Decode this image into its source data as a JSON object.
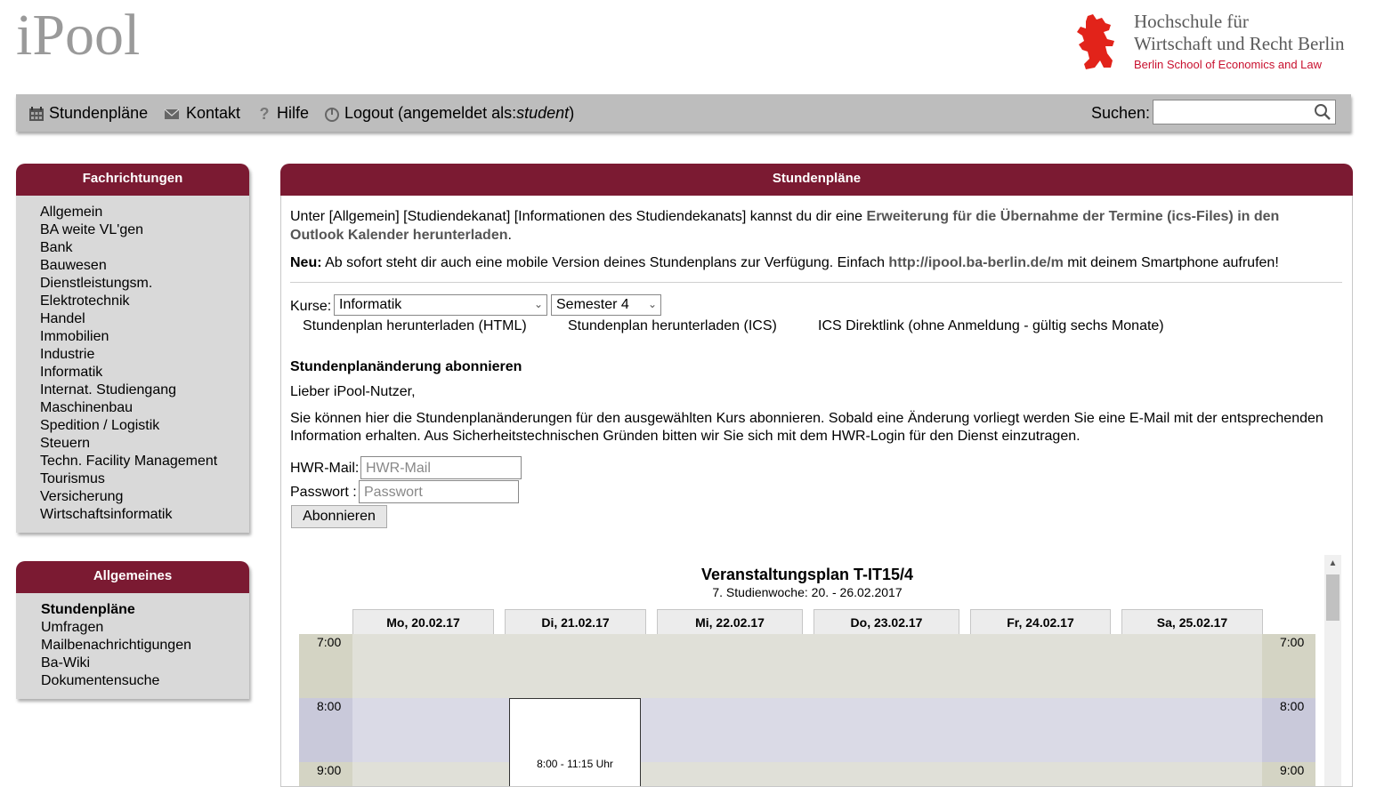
{
  "header": {
    "logo": "iPool",
    "hwr_line1": "Hochschule für",
    "hwr_line2": "Wirtschaft und Recht Berlin",
    "hwr_line3": "Berlin School of Economics and Law",
    "brand_color": "#7b1a32",
    "hwr_red": "#c8102e"
  },
  "topnav": {
    "items": [
      {
        "label": "Stundenpläne",
        "icon": "calendar-icon"
      },
      {
        "label": "Kontakt",
        "icon": "envelope-icon"
      },
      {
        "label": "Hilfe",
        "icon": "question-icon"
      },
      {
        "label": "Logout (angemeldet als: ",
        "icon": "power-icon",
        "user": "student",
        "close": ")"
      }
    ],
    "search_label": "Suchen:",
    "search_placeholder": ""
  },
  "fachrichtungen": {
    "title": "Fachrichtungen",
    "items": [
      "Allgemein",
      "BA weite VL'gen",
      "Bank",
      "Bauwesen",
      "Dienstleistungsm.",
      "Elektrotechnik",
      "Handel",
      "Immobilien",
      "Industrie",
      "Informatik",
      "Internat. Studiengang",
      "Maschinenbau",
      "Spedition / Logistik",
      "Steuern",
      "Techn. Facility Management",
      "Tourismus",
      "Versicherung",
      "Wirtschaftsinformatik"
    ]
  },
  "allgemeines": {
    "title": "Allgemeines",
    "items": [
      "Stundenpläne",
      "Umfragen",
      "Mailbenachrichtigungen",
      "Ba-Wiki",
      "Dokumentensuche"
    ],
    "active_index": 0
  },
  "main": {
    "title": "Stundenpläne",
    "info1_pre": "Unter [Allgemein] [Studiendekanat] [Informationen des Studiendekanats] kannst du dir eine ",
    "info1_link": "Erweiterung für die Übernahme der Termine (ics-Files) in den Outlook Kalender herunterladen",
    "info1_post": ".",
    "info2_bold": "Neu:",
    "info2_pre": " Ab sofort steht dir auch eine mobile Version deines Stundenplans zur Verfügung. Einfach ",
    "info2_link": "http://ipool.ba-berlin.de/m",
    "info2_post": " mit deinem Smartphone aufrufen!",
    "kurse_label": "Kurse:",
    "kurs_selected": "Informatik",
    "semester_selected": "Semester 4",
    "download_html": "Stundenplan herunterladen (HTML)",
    "download_ics": "Stundenplan herunterladen (ICS)",
    "ics_direct": "ICS Direktlink (ohne Anmeldung - gültig sechs Monate)",
    "subscribe_title": "Stundenplanänderung abonnieren",
    "greeting": "Lieber iPool-Nutzer,",
    "subscribe_text": "Sie können hier die Stundenplanänderungen für den ausgewählten Kurs abonnieren. Sobald eine Änderung vorliegt werden Sie eine E-Mail mit der entsprechenden Information erhalten. Aus Sicherheitstechnischen Gründen bitten wir Sie sich mit dem HWR-Login für den Dienst einzutragen.",
    "mail_label": "HWR-Mail:",
    "mail_placeholder": "HWR-Mail",
    "password_label": "Passwort :",
    "password_placeholder": "Passwort",
    "subscribe_button": "Abonnieren"
  },
  "plan": {
    "title": "Veranstaltungsplan T-IT15/4",
    "subtitle": "7. Studienwoche: 20. - 26.02.2017",
    "days": [
      "Mo, 20.02.17",
      "Di, 21.02.17",
      "Mi, 22.02.17",
      "Do, 23.02.17",
      "Fr, 24.02.17",
      "Sa, 25.02.17"
    ],
    "times": [
      "7:00",
      "8:00",
      "9:00"
    ],
    "event_time": "8:00 - 11:15 Uhr"
  }
}
